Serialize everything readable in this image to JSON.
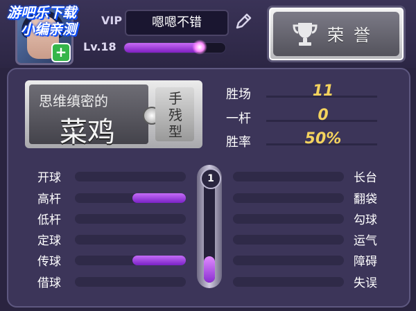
{
  "profile": {
    "vip_label": "VIP",
    "name": "嗯嗯不错",
    "level": "Lv.18",
    "xp_fraction": 0.75
  },
  "watermark": {
    "line1": "游吧乐下载",
    "line2": "小编亲测"
  },
  "honor_button": {
    "label": "荣誉"
  },
  "title_card": {
    "line1": "思维缜密的",
    "line2": "菜鸡",
    "side": "手残型"
  },
  "stats": [
    {
      "label": "胜场",
      "value": "11"
    },
    {
      "label": "一杆",
      "value": "0"
    },
    {
      "label": "胜率",
      "value": "50%"
    }
  ],
  "skills_left": [
    {
      "label": "开球",
      "value": 0
    },
    {
      "label": "高杆",
      "value": 0.48
    },
    {
      "label": "低杆",
      "value": 0
    },
    {
      "label": "定球",
      "value": 0
    },
    {
      "label": "传球",
      "value": 0.48
    },
    {
      "label": "借球",
      "value": 0
    }
  ],
  "skills_right": [
    {
      "label": "长台",
      "value": 0
    },
    {
      "label": "翻袋",
      "value": 0
    },
    {
      "label": "勾球",
      "value": 0
    },
    {
      "label": "运气",
      "value": 0
    },
    {
      "label": "障碍",
      "value": 0
    },
    {
      "label": "失误",
      "value": 0
    }
  ],
  "cue": {
    "level": "1"
  },
  "colors": {
    "accent": "#9b3fe0",
    "stat_value": "#f4d35e",
    "background": "#2a2440"
  }
}
